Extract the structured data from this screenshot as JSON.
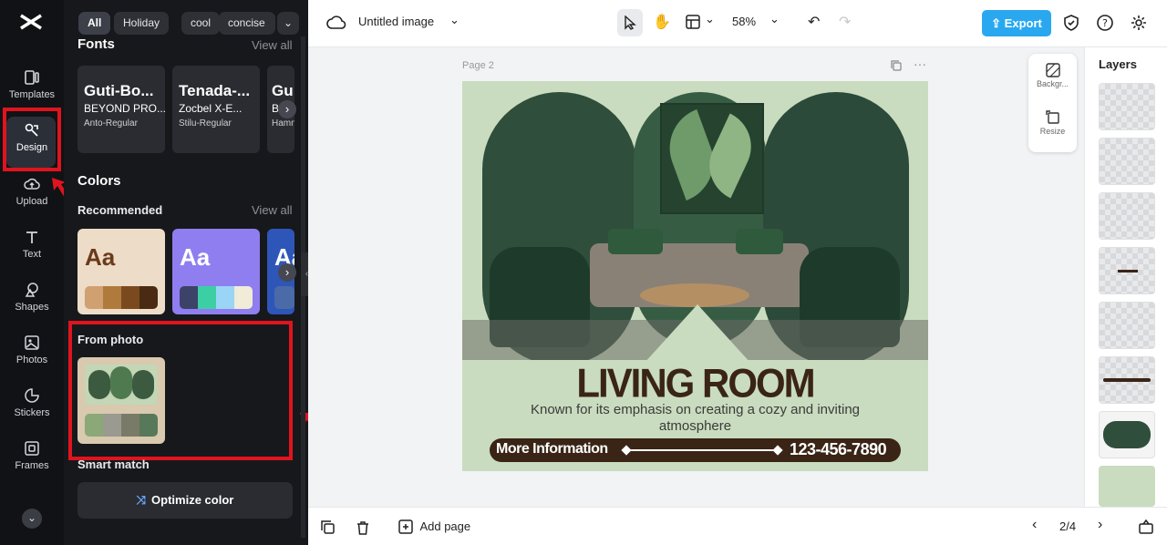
{
  "rail": {
    "items": [
      {
        "label": "Templates"
      },
      {
        "label": "Design"
      },
      {
        "label": "Upload"
      },
      {
        "label": "Text"
      },
      {
        "label": "Shapes"
      },
      {
        "label": "Photos"
      },
      {
        "label": "Stickers"
      },
      {
        "label": "Frames"
      }
    ]
  },
  "panel": {
    "chips": [
      "All",
      "Holiday",
      "cool",
      "concise"
    ],
    "fonts_title": "Fonts",
    "fonts_view_all": "View all",
    "font_cards": [
      {
        "big": "Guti-Bo...",
        "med": "BEYOND PRO...",
        "small": "Anto-Regular"
      },
      {
        "big": "Tenada-...",
        "med": "Zocbel X-E...",
        "small": "Stilu-Regular"
      },
      {
        "big": "Gu",
        "med": "B",
        "small": "Hamn"
      }
    ],
    "colors_title": "Colors",
    "recommended_label": "Recommended",
    "recommended_view_all": "View all",
    "swatch_text": "Aa",
    "from_photo_label": "From photo",
    "smart_match_label": "Smart match",
    "optimize_label": "Optimize color",
    "palettes": [
      [
        "#d0a070",
        "#b07a3c",
        "#7a4a1e",
        "#4a2a12"
      ],
      [
        "#3d4268",
        "#3ccfa4",
        "#9ad5f5",
        "#f0ecd8"
      ],
      [
        "#4a6aa8",
        "#7aa0e0",
        "#a0c0f0",
        "#d0e0f8"
      ]
    ],
    "photo_palette": [
      "#8aa878",
      "#9a9a90",
      "#7a7a68",
      "#58785a"
    ]
  },
  "topbar": {
    "doc_title": "Untitled image",
    "zoom": "58%",
    "export_label": "Export"
  },
  "canvas": {
    "page_label": "Page 2",
    "poster": {
      "title": "LIVING ROOM",
      "subtitle": "Known for its emphasis on creating a cozy and inviting atmosphere",
      "cta": "More Information",
      "phone": "123-456-7890"
    }
  },
  "floatbar": {
    "background_label": "Backgr...",
    "resize_label": "Resize"
  },
  "layers": {
    "title": "Layers"
  },
  "bottombar": {
    "add_page_label": "Add page",
    "page_counter": "2/4"
  },
  "colors": {
    "accent": "#29a8f0",
    "highlight": "#e0141e",
    "poster_bg": "#c9dcbf",
    "poster_text": "#3a2416"
  }
}
